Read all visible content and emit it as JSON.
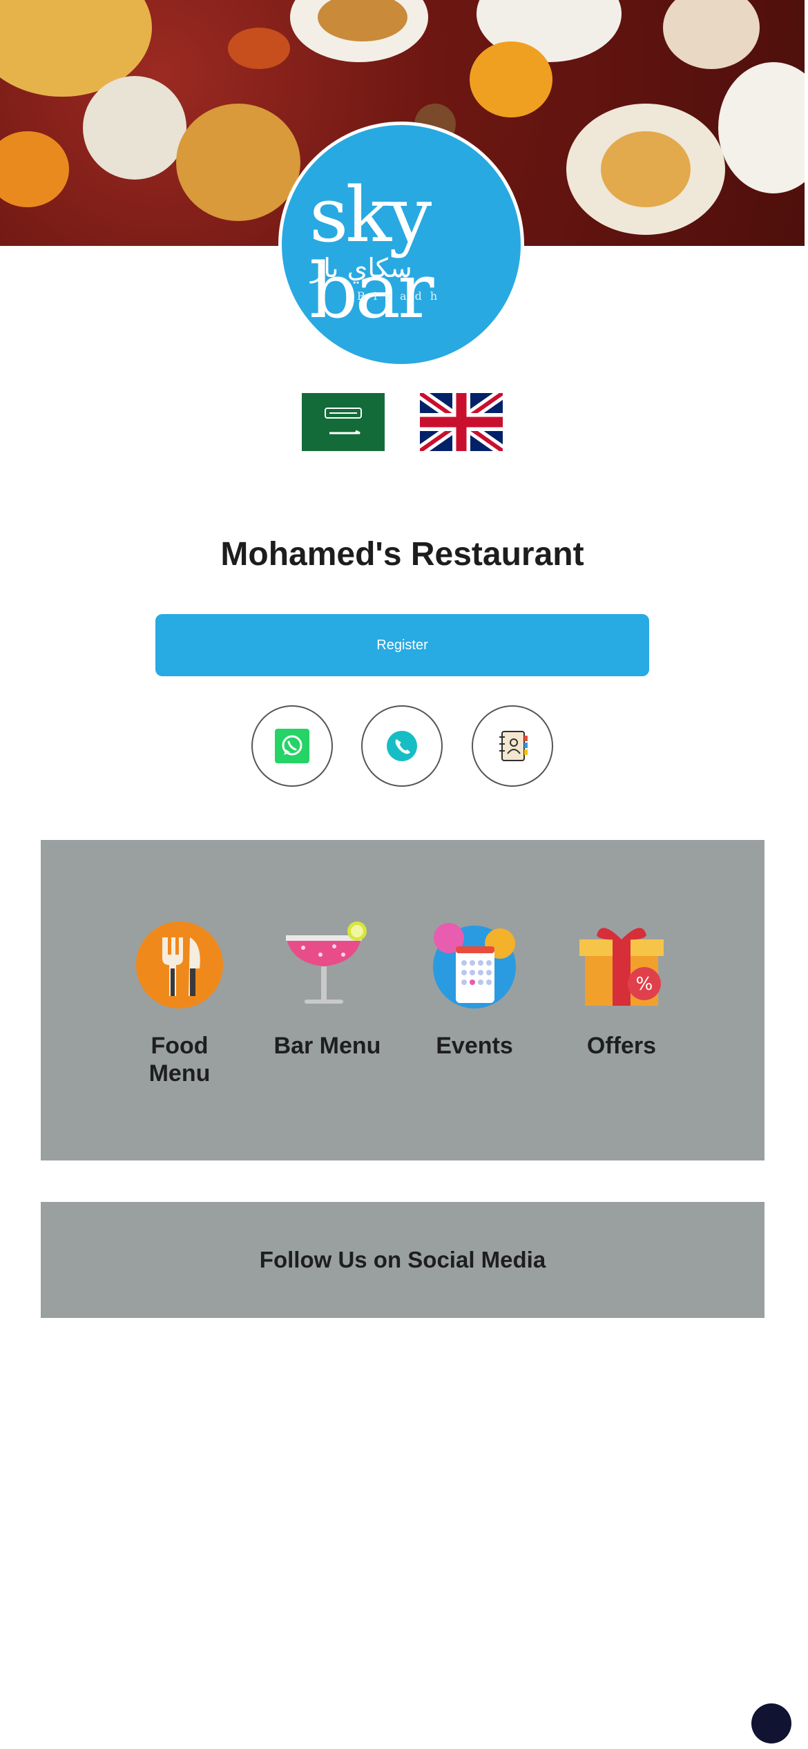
{
  "logo": {
    "brand": "sky bar",
    "arabic": "سكاي بار",
    "city": "Riyadh"
  },
  "languages": [
    {
      "name": "Arabic",
      "flag": "saudi-flag"
    },
    {
      "name": "English",
      "flag": "uk-flag"
    }
  ],
  "restaurant": {
    "name": "Mohamed's Restaurant"
  },
  "register_label": "Register",
  "contacts": [
    {
      "icon": "whatsapp-icon"
    },
    {
      "icon": "phone-icon"
    },
    {
      "icon": "contacts-book-icon"
    }
  ],
  "categories": [
    {
      "label": "Food Menu",
      "icon": "fork-knife-icon"
    },
    {
      "label": "Bar Menu",
      "icon": "cocktail-icon"
    },
    {
      "label": "Events",
      "icon": "calendar-balloons-icon"
    },
    {
      "label": "Offers",
      "icon": "gift-percent-icon"
    }
  ],
  "social": {
    "title": "Follow Us on Social Media"
  },
  "colors": {
    "accent": "#29a9e1",
    "panel": "#9aa0a0",
    "fab": "#101432"
  }
}
